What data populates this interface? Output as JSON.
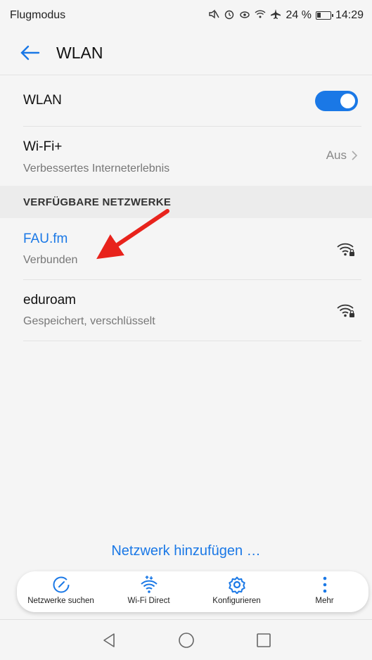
{
  "status_bar": {
    "mode": "Flugmodus",
    "battery_percent": "24 %",
    "time": "14:29",
    "icons": [
      "mute-icon",
      "alarm-icon",
      "eye-comfort-icon",
      "wifi-icon",
      "airplane-icon",
      "battery-icon"
    ]
  },
  "app_bar": {
    "title": "WLAN",
    "back_icon": "arrow-left-icon"
  },
  "wlan_toggle": {
    "label": "WLAN",
    "enabled": true,
    "color": "#1a78e6"
  },
  "wifi_plus": {
    "title": "Wi-Fi+",
    "subtitle": "Verbessertes Interneterlebnis",
    "value": "Aus"
  },
  "section": {
    "header": "VERFÜGBARE NETZWERKE"
  },
  "networks": [
    {
      "name": "FAU.fm",
      "status": "Verbunden",
      "connected": true,
      "icon": "wifi-lock-icon"
    },
    {
      "name": "eduroam",
      "status": "Gespeichert, verschlüsselt",
      "connected": false,
      "icon": "wifi-lock-icon"
    }
  ],
  "add_network": {
    "label": "Netzwerk hinzufügen …"
  },
  "toolbar": {
    "items": [
      {
        "label": "Netzwerke suchen",
        "icon": "scan-icon"
      },
      {
        "label": "Wi-Fi Direct",
        "icon": "wifi-direct-icon"
      },
      {
        "label": "Konfigurieren",
        "icon": "gear-icon"
      },
      {
        "label": "Mehr",
        "icon": "more-vertical-icon"
      }
    ]
  },
  "nav_bar": {
    "icons": [
      "nav-back-icon",
      "nav-home-icon",
      "nav-recents-icon"
    ]
  },
  "colors": {
    "accent": "#1a78e6",
    "annotation_arrow": "#e8231c"
  }
}
